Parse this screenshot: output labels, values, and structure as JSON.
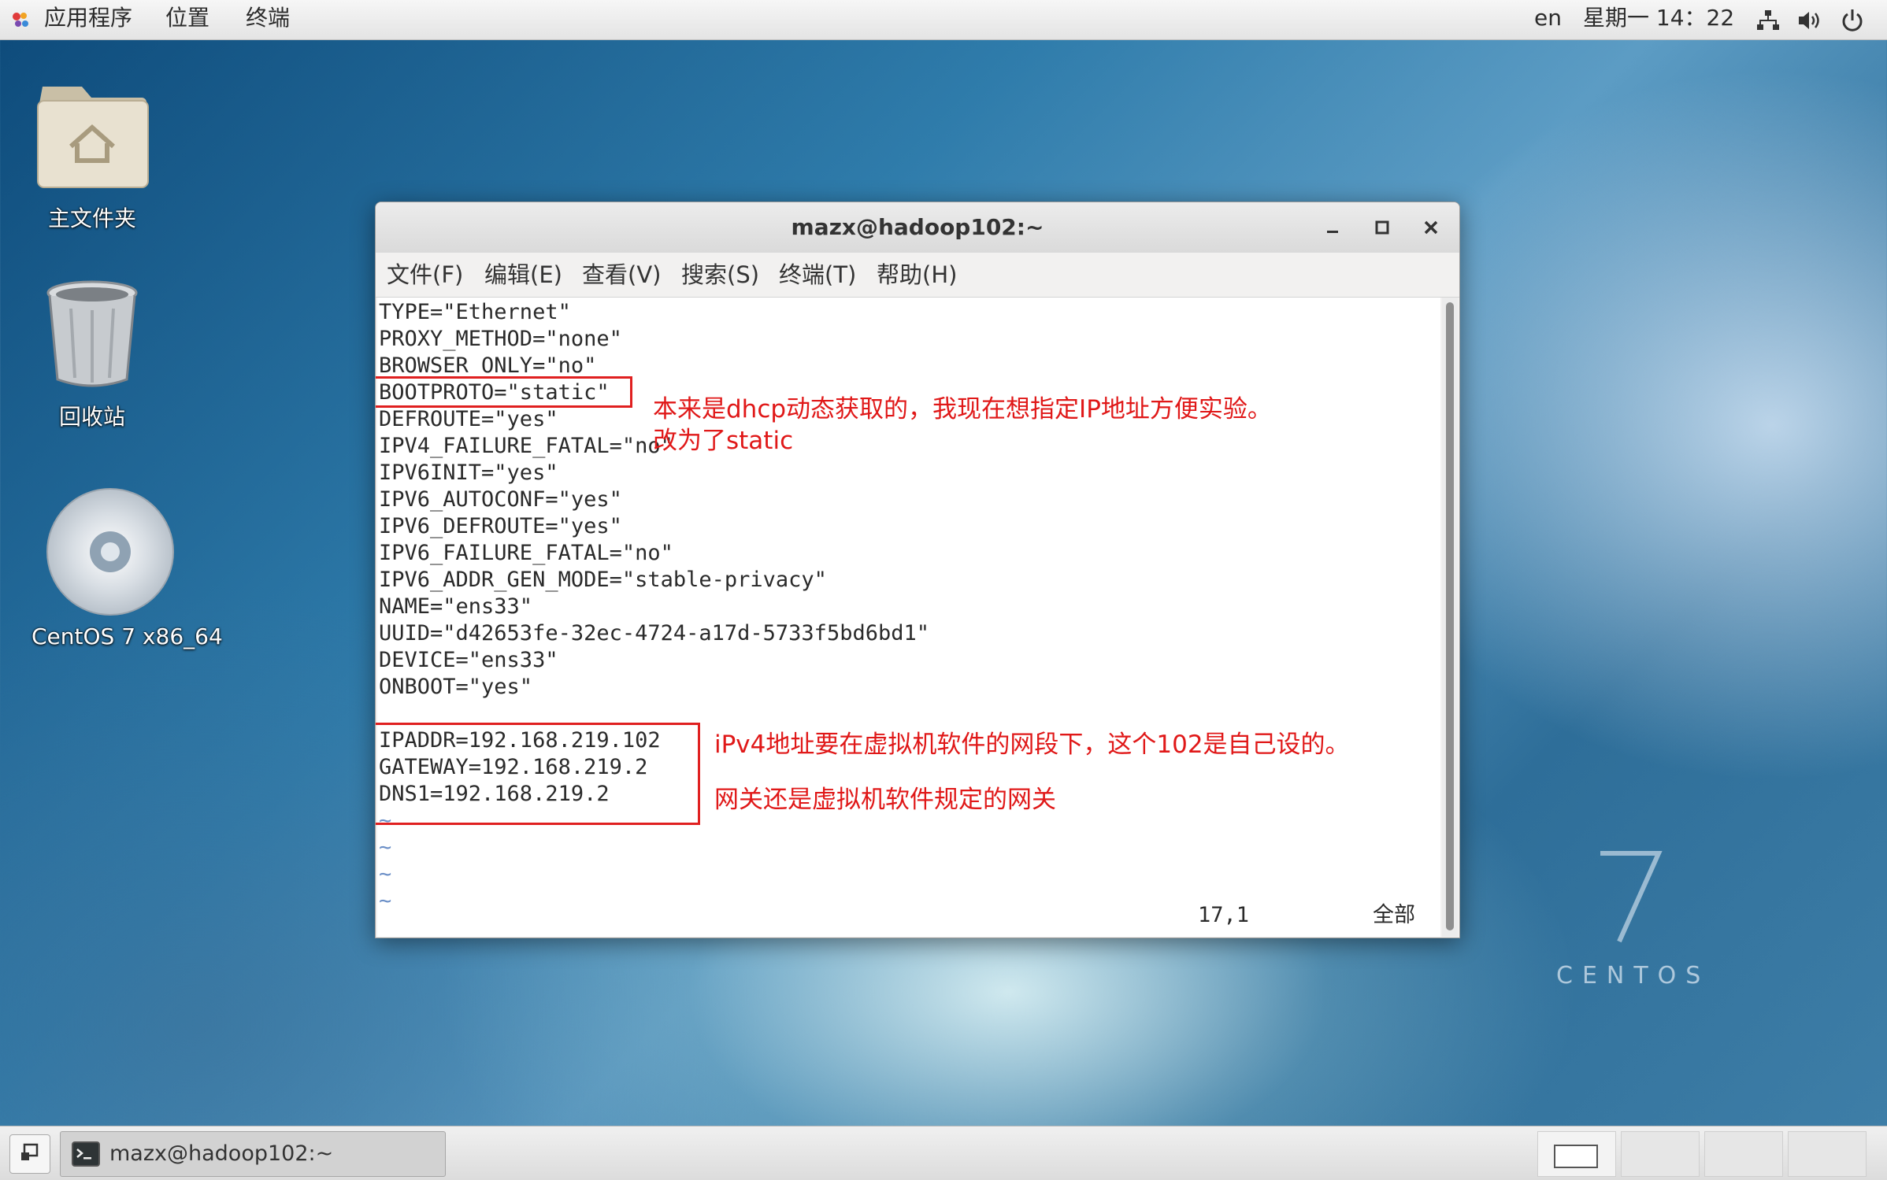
{
  "topbar": {
    "applications": "应用程序",
    "places": "位置",
    "terminal": "终端",
    "lang": "en",
    "clock": "星期一 14：22"
  },
  "desktop": {
    "home_folder": "主文件夹",
    "trash": "回收站",
    "dvd": "CentOS 7 x86_64"
  },
  "window": {
    "title": "mazx@hadoop102:~",
    "menus": [
      "文件(F)",
      "编辑(E)",
      "查看(V)",
      "搜索(S)",
      "终端(T)",
      "帮助(H)"
    ],
    "lines": [
      "TYPE=\"Ethernet\"",
      "PROXY_METHOD=\"none\"",
      "BROWSER_ONLY=\"no\"",
      "BOOTPROTO=\"static\"",
      "DEFROUTE=\"yes\"",
      "IPV4_FAILURE_FATAL=\"no\"",
      "IPV6INIT=\"yes\"",
      "IPV6_AUTOCONF=\"yes\"",
      "IPV6_DEFROUTE=\"yes\"",
      "IPV6_FAILURE_FATAL=\"no\"",
      "IPV6_ADDR_GEN_MODE=\"stable-privacy\"",
      "NAME=\"ens33\"",
      "UUID=\"d42653fe-32ec-4724-a17d-5733f5bd6bd1\"",
      "DEVICE=\"ens33\"",
      "ONBOOT=\"yes\"",
      "",
      "IPADDR=192.168.219.102",
      "GATEWAY=192.168.219.2",
      "DNS1=192.168.219.2",
      "~",
      "~",
      "~",
      "~"
    ],
    "status_position": "17,1",
    "status_scope": "全部"
  },
  "annotations": {
    "bootproto_note_1": "本来是dhcp动态获取的，我现在想指定IP地址方便实验。",
    "bootproto_note_2": "改为了static",
    "ipv4_note": "iPv4地址要在虚拟机软件的网段下，这个102是自己设的。",
    "gateway_note": "网关还是虚拟机软件规定的网关"
  },
  "taskbar": {
    "task_label": "mazx@hadoop102:~"
  },
  "branding": {
    "version": "7",
    "name": "CENTOS"
  },
  "colors": {
    "annotation": "#e02020",
    "tilde": "#6b8fc7"
  }
}
